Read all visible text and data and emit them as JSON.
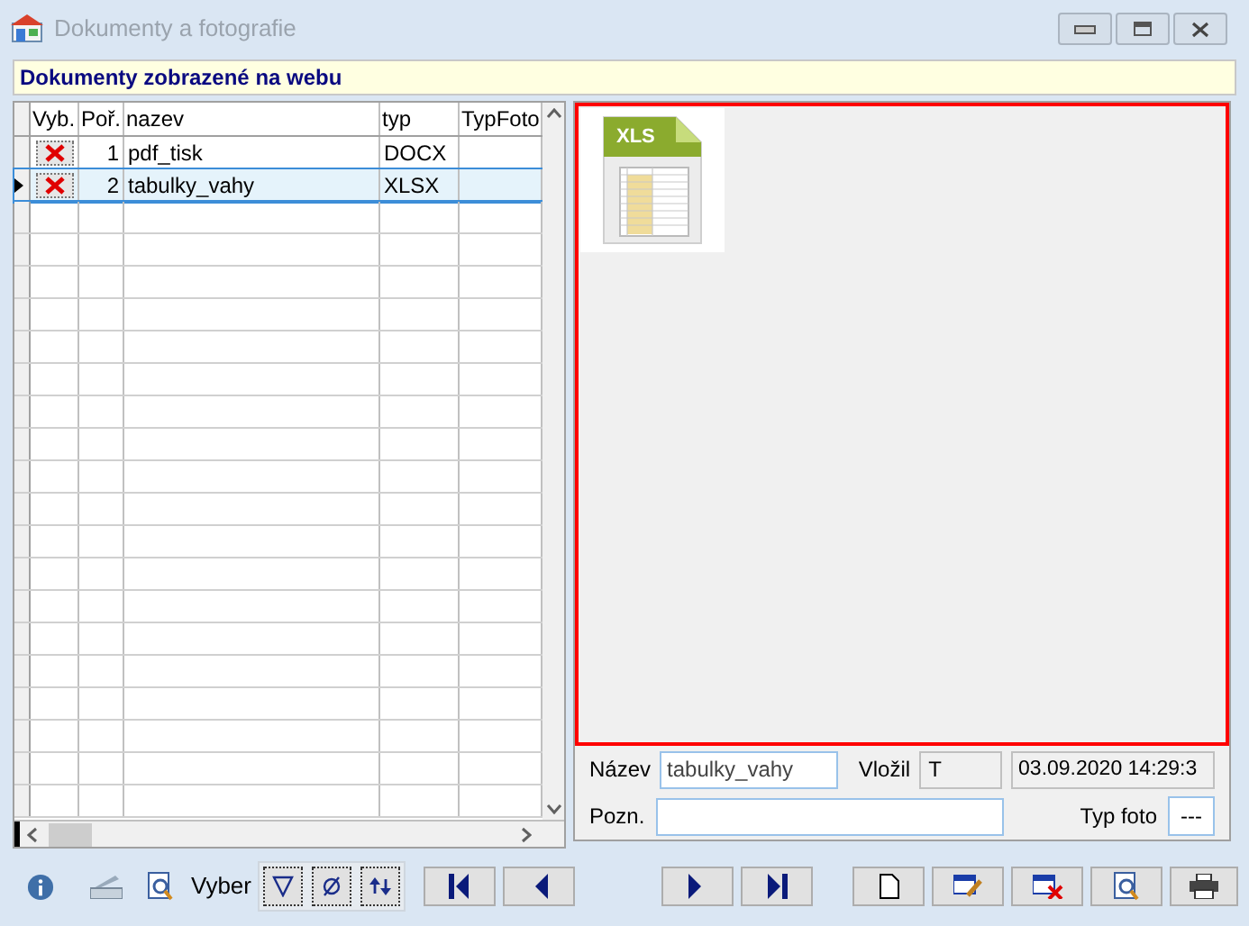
{
  "window": {
    "title": "Dokumenty a fotografie"
  },
  "header": "Dokumenty zobrazené na webu",
  "grid": {
    "columns": [
      "Vyb.",
      "Poř.",
      "nazev",
      "typ",
      "TypFoto"
    ],
    "rows": [
      {
        "selected": false,
        "checked": true,
        "order": "1",
        "name": "pdf_tisk",
        "type": "DOCX"
      },
      {
        "selected": true,
        "checked": true,
        "order": "2",
        "name": "tabulky_vahy",
        "type": "XLSX"
      }
    ]
  },
  "preview": {
    "thumbnail_label": "XLS"
  },
  "detail": {
    "name_label": "Název",
    "name_value": "tabulky_vahy",
    "inserted_label": "Vložil",
    "inserted_by": "T",
    "inserted_at": "03.09.2020 14:29:3",
    "note_label": "Pozn.",
    "photo_type_label": "Typ foto",
    "photo_type_value": "---"
  },
  "toolbar": {
    "filter_label": "Vyber"
  }
}
